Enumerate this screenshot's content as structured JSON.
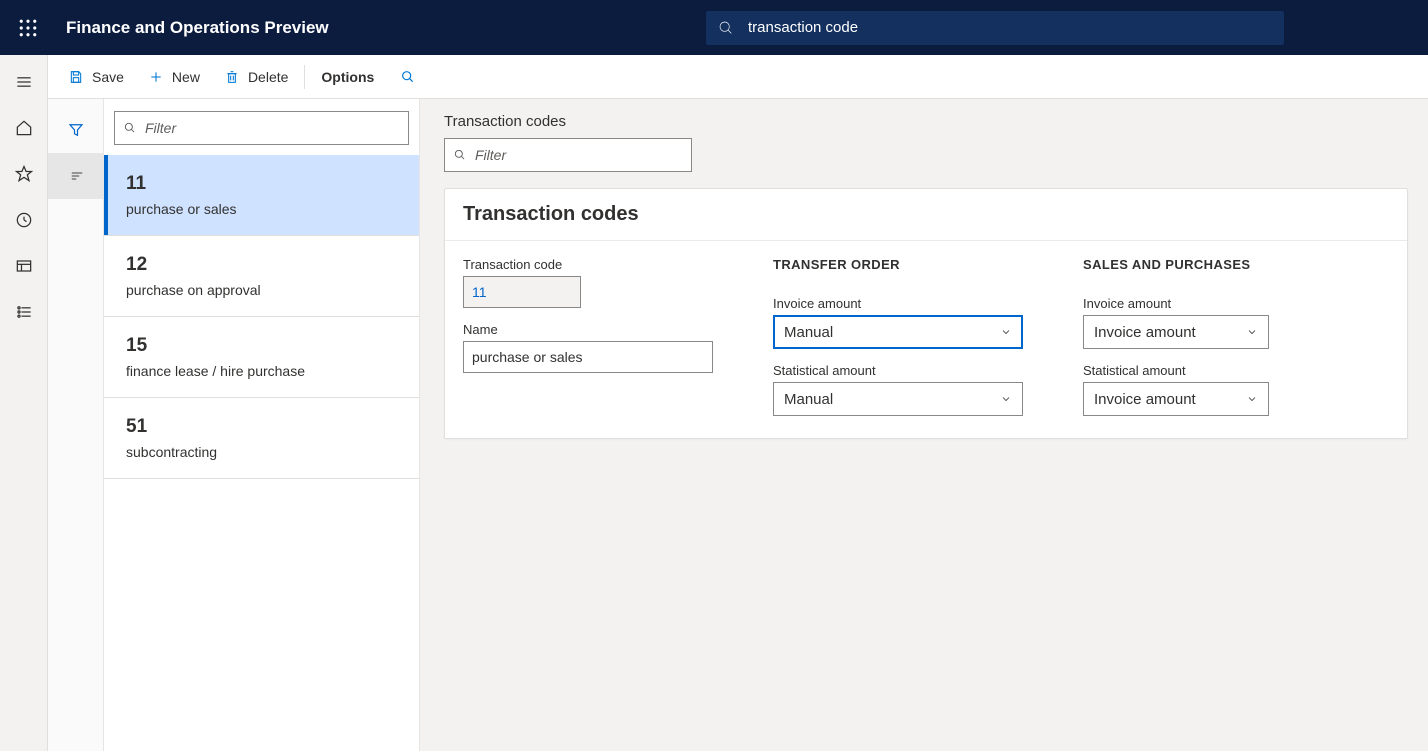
{
  "header": {
    "app_title": "Finance and Operations Preview",
    "search_value": "transaction code"
  },
  "actions": {
    "save": "Save",
    "new": "New",
    "delete": "Delete",
    "options": "Options"
  },
  "list": {
    "filter_placeholder": "Filter",
    "items": [
      {
        "code": "11",
        "desc": "purchase or sales"
      },
      {
        "code": "12",
        "desc": "purchase on approval"
      },
      {
        "code": "15",
        "desc": "finance lease / hire purchase"
      },
      {
        "code": "51",
        "desc": "subcontracting"
      }
    ]
  },
  "detail": {
    "heading": "Transaction codes",
    "filter_placeholder": "Filter",
    "card_title": "Transaction codes",
    "transaction_code_label": "Transaction code",
    "transaction_code_value": "11",
    "name_label": "Name",
    "name_value": "purchase or sales",
    "transfer_order_section": "TRANSFER ORDER",
    "sales_purchases_section": "SALES AND PURCHASES",
    "invoice_amount_label": "Invoice amount",
    "statistical_amount_label": "Statistical amount",
    "transfer_invoice_value": "Manual",
    "transfer_statistical_value": "Manual",
    "sales_invoice_value": "Invoice amount",
    "sales_statistical_value": "Invoice amount"
  }
}
